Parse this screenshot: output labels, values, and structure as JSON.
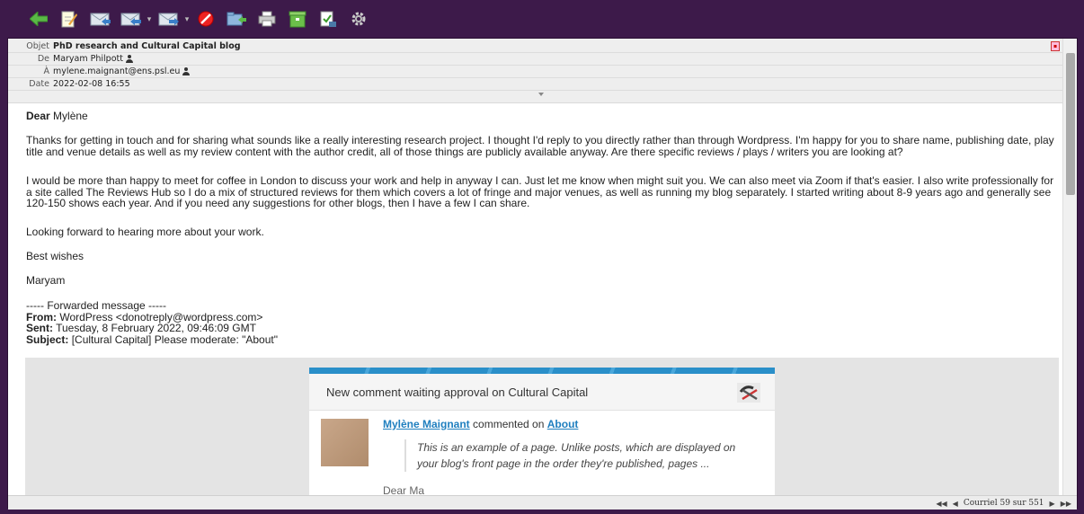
{
  "toolbar": {
    "buttons": [
      {
        "name": "back",
        "icon": "back-arrow-icon"
      },
      {
        "name": "compose",
        "icon": "compose-icon"
      },
      {
        "name": "reply",
        "icon": "reply-icon"
      },
      {
        "name": "reply-all",
        "icon": "reply-all-icon"
      },
      {
        "name": "forward",
        "icon": "forward-icon"
      },
      {
        "name": "spam",
        "icon": "block-icon"
      },
      {
        "name": "move",
        "icon": "move-icon"
      },
      {
        "name": "print",
        "icon": "print-icon"
      },
      {
        "name": "archive",
        "icon": "archive-icon"
      },
      {
        "name": "mark",
        "icon": "mark-icon"
      },
      {
        "name": "settings",
        "icon": "gear-icon"
      }
    ],
    "accent": "#3d1a4a"
  },
  "header": {
    "subject_label": "Objet",
    "subject": "PhD research and Cultural Capital blog",
    "from_label": "De",
    "from": "Maryam Philpott",
    "to_label": "À",
    "to": "mylene.maignant@ens.psl.eu",
    "date_label": "Date",
    "date": "2022-02-08 16:55"
  },
  "message": {
    "greeting_bold": "Dear",
    "greeting_name": "Mylène",
    "para1": "Thanks for getting in touch and for sharing what sounds like a really interesting research project. I thought I'd reply to you directly rather than through Wordpress. I'm happy for you to share name, publishing date, play title and venue details as well as my review content with the author credit, all of those things are publicly available anyway. Are there specific reviews / plays / writers you are looking at?",
    "para2": "I would be more than happy to meet for coffee in London to discuss your work and help in anyway I can. Just let me know when might suit you. We can also meet via Zoom if that's easier. I also write professionally for a site called The Reviews Hub so I do a mix of structured reviews for them which covers a lot of fringe and major venues, as well as running my blog separately. I started writing about 8-9 years ago and generally see 120-150 shows each year. And if you need any suggestions for other blogs, then I have a few I can share.",
    "para3": "Looking forward to hearing more about your work.",
    "signoff": "Best wishes",
    "signature": "Maryam",
    "fwd_divider": "----- Forwarded message -----",
    "fwd_from_label": "From:",
    "fwd_from": "WordPress <donotreply@wordpress.com>",
    "fwd_sent_label": "Sent:",
    "fwd_sent": "Tuesday, 8 February 2022, 09:46:09 GMT",
    "fwd_subject_label": "Subject:",
    "fwd_subject": "[Cultural Capital] Please moderate: \"About\""
  },
  "embed": {
    "title": "New comment waiting approval on Cultural Capital",
    "commenter": "Mylène Maignant",
    "commented_on": "commented on",
    "post": "About",
    "quote": "This is an example of a page. Unlike posts, which are displayed on your blog's front page in the order they're published, pages ...",
    "cut_text": "Dear Ma",
    "link_color": "#1f7fbf"
  },
  "status": {
    "counter": "Courriel 59 sur 551"
  }
}
